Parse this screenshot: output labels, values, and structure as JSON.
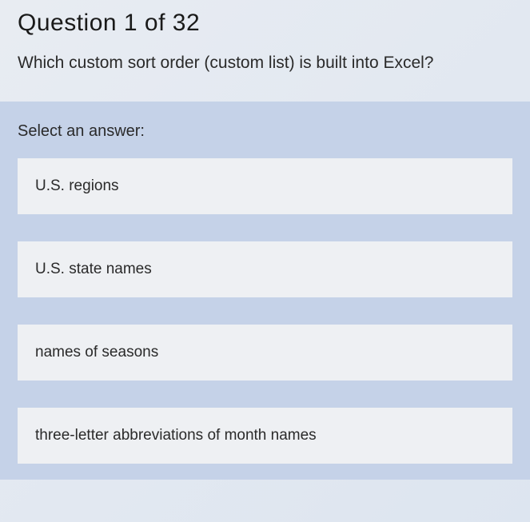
{
  "header": {
    "title": "Question 1 of 32"
  },
  "question": {
    "text": "Which custom sort order (custom list) is built into Excel?"
  },
  "answer": {
    "prompt": "Select an answer:",
    "options": [
      "U.S. regions",
      "U.S. state names",
      "names of seasons",
      "three-letter abbreviations of month names"
    ]
  }
}
